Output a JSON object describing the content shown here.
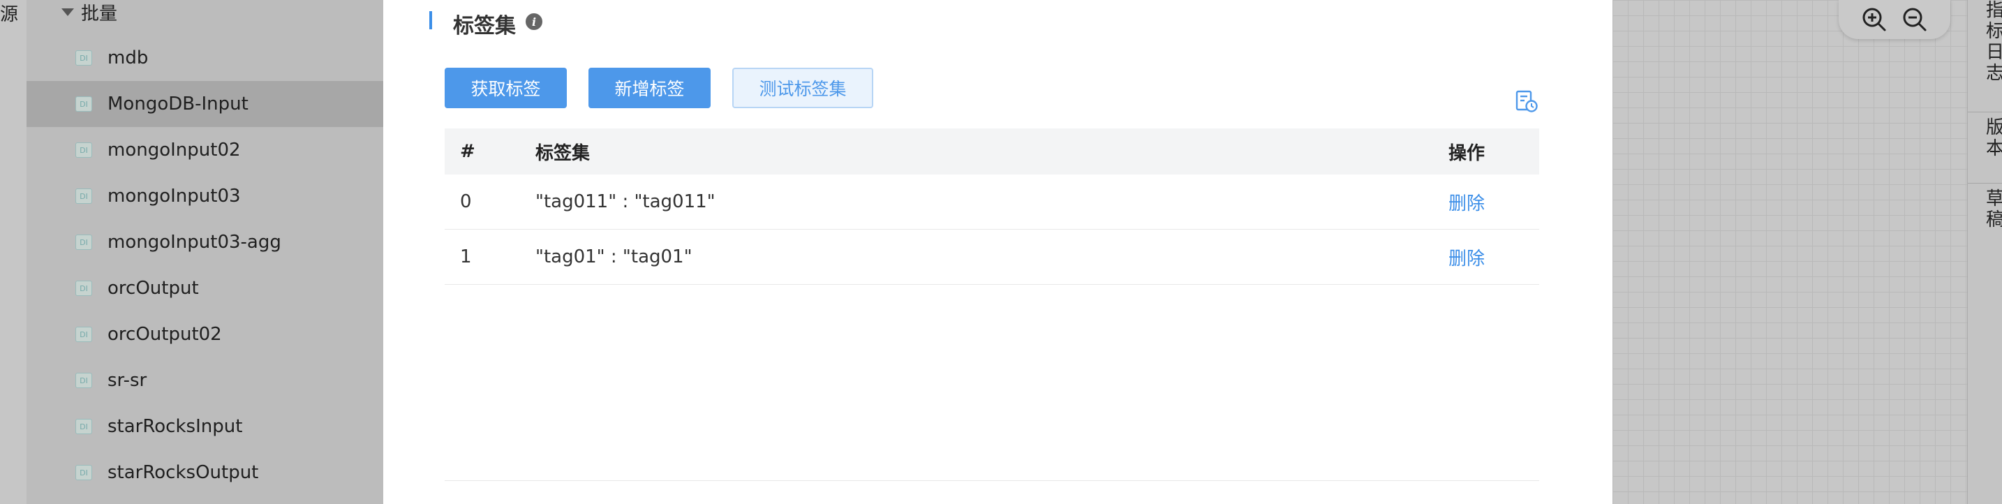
{
  "left_edge": {
    "text": "源"
  },
  "sidebar": {
    "group_label": "批量",
    "badge_text": "DI",
    "items": [
      {
        "label": "mdb"
      },
      {
        "label": "MongoDB-Input",
        "selected": true
      },
      {
        "label": "mongoInput02"
      },
      {
        "label": "mongoInput03"
      },
      {
        "label": "mongoInput03-agg"
      },
      {
        "label": "orcOutput"
      },
      {
        "label": "orcOutput02"
      },
      {
        "label": "sr-sr"
      },
      {
        "label": "starRocksInput"
      },
      {
        "label": "starRocksOutput"
      }
    ]
  },
  "modal": {
    "section_title": "标签集",
    "buttons": {
      "fetch": "获取标签",
      "add": "新增标签",
      "test": "测试标签集"
    },
    "table": {
      "headers": {
        "index": "#",
        "tags": "标签集",
        "op": "操作"
      },
      "rows": [
        {
          "index": "0",
          "tag": "\"tag011\" : \"tag011\"",
          "op": "删除"
        },
        {
          "index": "1",
          "tag": "\"tag01\" : \"tag01\"",
          "op": "删除"
        }
      ]
    }
  },
  "right_panel": {
    "tabs": [
      {
        "label": "指标日志"
      },
      {
        "label": "版本"
      },
      {
        "label": "草稿"
      }
    ]
  },
  "icons": {
    "info": "info-icon",
    "export": "document-history-icon",
    "zoom_in": "zoom-in-icon",
    "zoom_out": "zoom-out-icon",
    "collapse": "triangle-down-icon"
  },
  "colors": {
    "primary": "#4d98ea",
    "link": "#3b8ee8"
  }
}
